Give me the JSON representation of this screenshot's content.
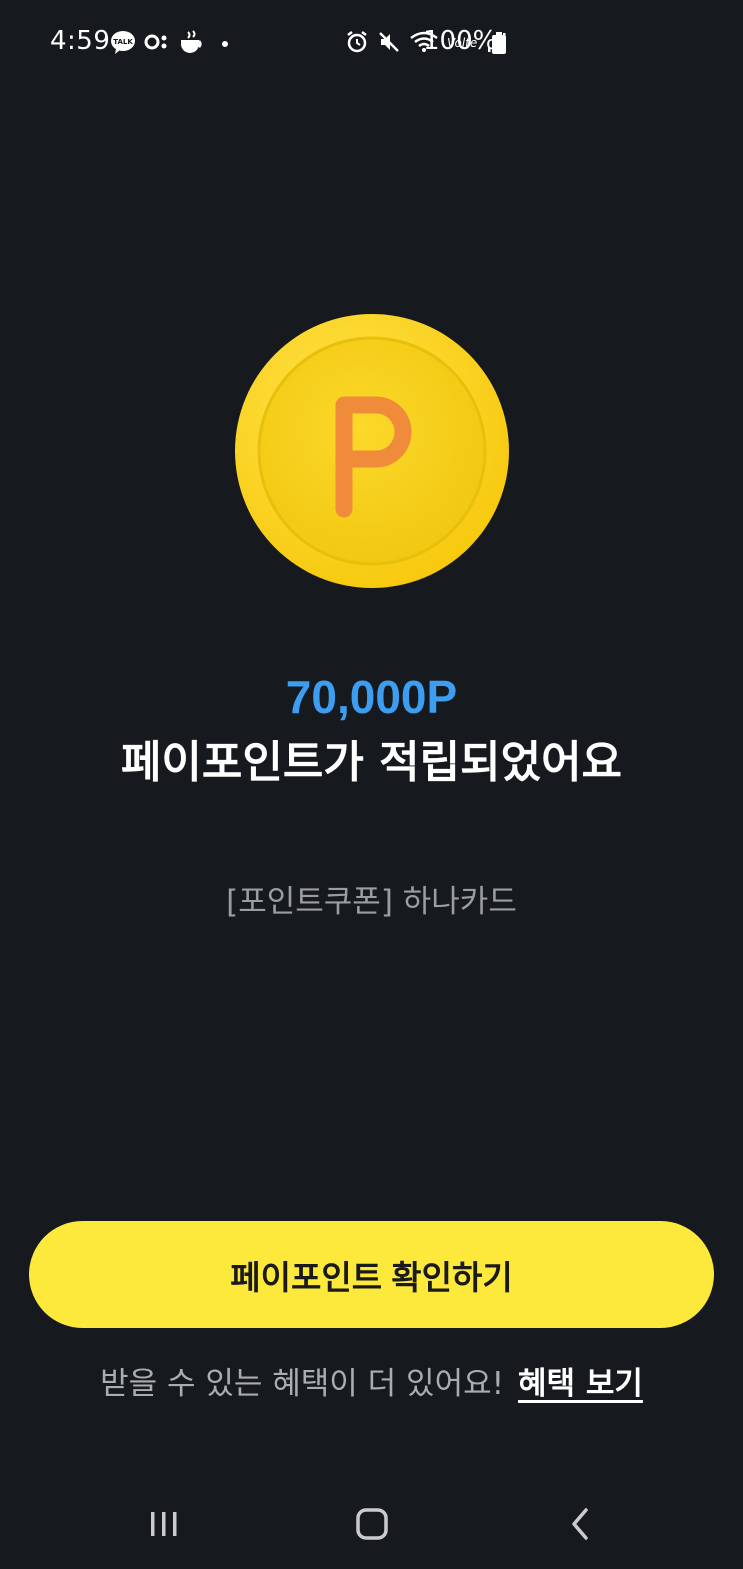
{
  "status_bar": {
    "time": "4:59",
    "battery": "100%",
    "left_icons": [
      "talk-icon",
      "dots-icon",
      "coffee-icon",
      "dot-icon"
    ],
    "right_icons": [
      "alarm-icon",
      "mute-icon",
      "wifi-icon",
      "volte-icon",
      "signal-icon"
    ]
  },
  "coin": {
    "letter": "P",
    "colors": {
      "outer": "#fcd713",
      "inner": "#f4cf12",
      "letter": "#f08b3b"
    }
  },
  "main": {
    "points": "70,000P",
    "headline": "페이포인트가 적립되었어요",
    "subtitle": "[포인트쿠폰] 하나카드"
  },
  "actions": {
    "confirm_label": "페이포인트 확인하기",
    "benefit_text": "받을 수 있는 혜택이 더 있어요!",
    "benefit_link": "혜택 보기"
  },
  "colors": {
    "background": "#16191d",
    "accent_blue": "#3d9df0",
    "button_yellow": "#fde93b"
  },
  "nav_bar": {
    "items": [
      "recent-apps-icon",
      "home-icon",
      "back-icon"
    ]
  }
}
